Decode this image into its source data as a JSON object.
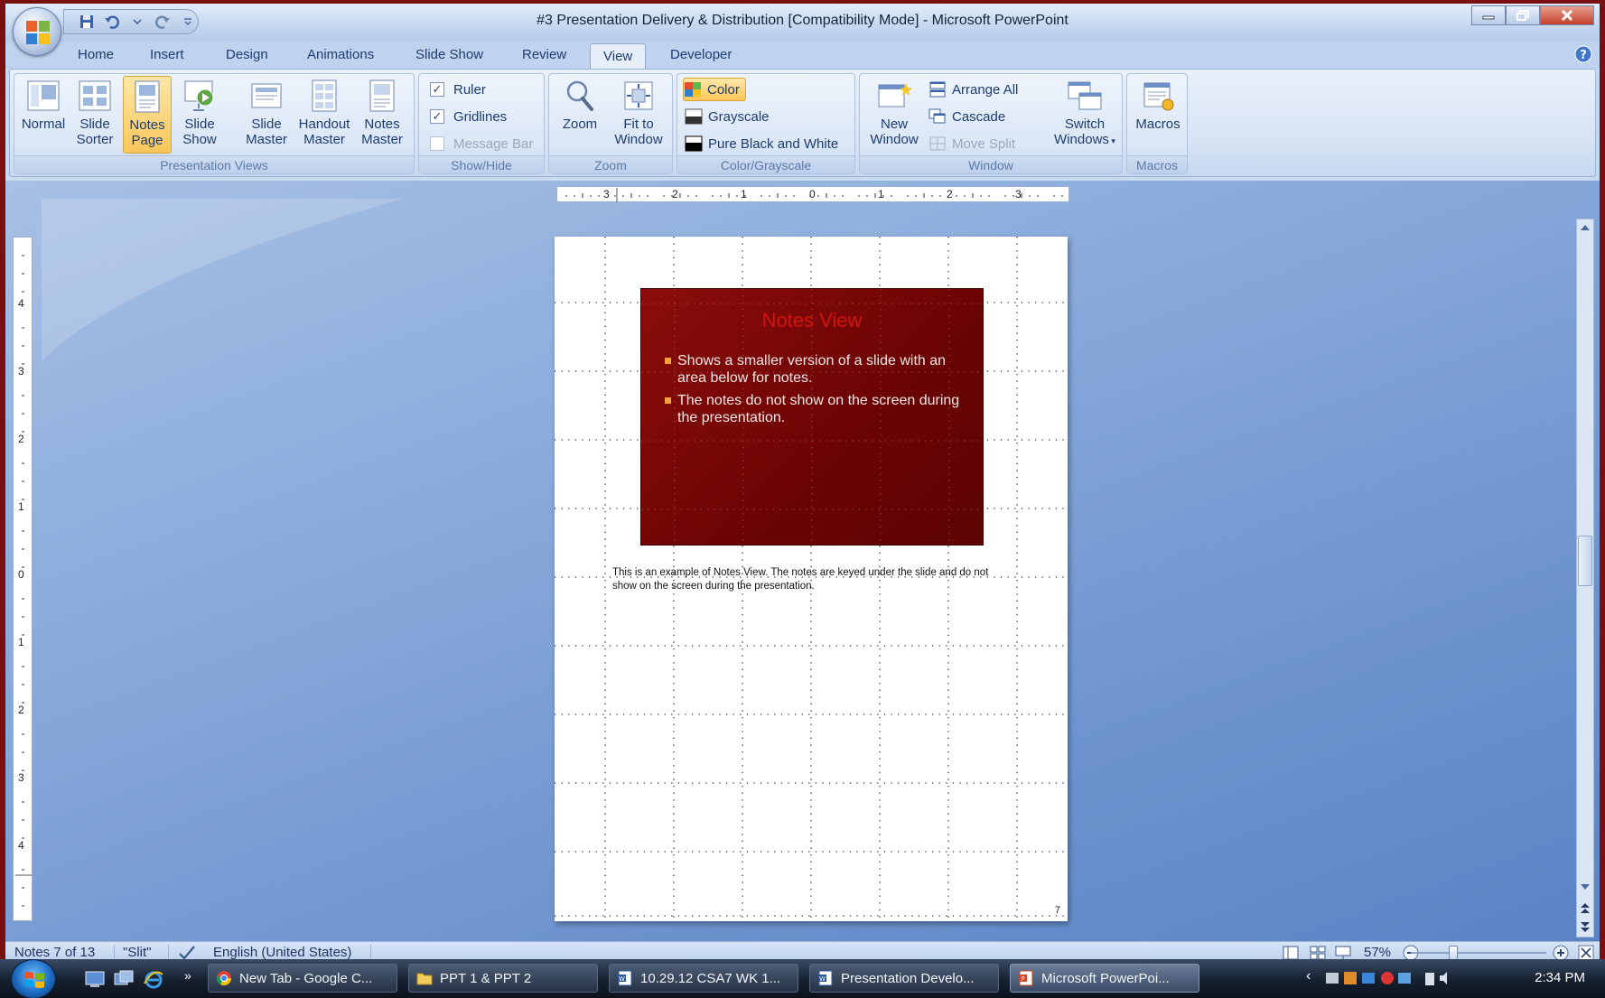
{
  "window": {
    "title": "#3 Presentation Delivery & Distribution [Compatibility Mode] - Microsoft PowerPoint"
  },
  "tabs": [
    "Home",
    "Insert",
    "Design",
    "Animations",
    "Slide Show",
    "Review",
    "View",
    "Developer"
  ],
  "active_tab": "View",
  "ribbon": {
    "presentation_views": {
      "label": "Presentation Views",
      "buttons": [
        {
          "line1": "Normal",
          "line2": ""
        },
        {
          "line1": "Slide",
          "line2": "Sorter"
        },
        {
          "line1": "Notes",
          "line2": "Page"
        },
        {
          "line1": "Slide",
          "line2": "Show"
        },
        {
          "line1": "Slide",
          "line2": "Master"
        },
        {
          "line1": "Handout",
          "line2": "Master"
        },
        {
          "line1": "Notes",
          "line2": "Master"
        }
      ]
    },
    "show_hide": {
      "label": "Show/Hide",
      "ruler": "Ruler",
      "gridlines": "Gridlines",
      "message_bar": "Message Bar"
    },
    "zoom": {
      "label": "Zoom",
      "zoom_line1": "Zoom",
      "fit_line1": "Fit to",
      "fit_line2": "Window"
    },
    "color_grayscale": {
      "label": "Color/Grayscale",
      "color": "Color",
      "grayscale": "Grayscale",
      "pure_bw": "Pure Black and White"
    },
    "window": {
      "label": "Window",
      "new_line1": "New",
      "new_line2": "Window",
      "arrange_all": "Arrange All",
      "cascade": "Cascade",
      "move_split": "Move Split",
      "switch_line1": "Switch",
      "switch_line2": "Windows"
    },
    "macros": {
      "label": "Macros",
      "button": "Macros"
    }
  },
  "rulers": {
    "horizontal_labels": [
      "3",
      "2",
      "1",
      "0",
      "1",
      "2",
      "3"
    ],
    "vertical_labels": [
      "4",
      "3",
      "2",
      "1",
      "0",
      "1",
      "2",
      "3",
      "4"
    ]
  },
  "slide": {
    "title": "Notes View",
    "bullets": [
      "Shows a smaller version of a slide with an area below for notes.",
      "The notes do not show on the screen during the presentation."
    ]
  },
  "notes": {
    "text": "This is an example of Notes View.  The notes are keyed under the slide and do not show on the screen during the presentation.",
    "page_number": "7"
  },
  "statusbar": {
    "position": "Notes 7 of 13",
    "theme": "\"Slit\"",
    "language": "English (United States)",
    "zoom": "57%"
  },
  "taskbar": {
    "items": [
      "New Tab - Google C...",
      "PPT 1 & PPT 2",
      "10.29.12 CSA7 WK 1...",
      "Presentation Develo...",
      "Microsoft PowerPoi..."
    ],
    "clock": "2:34 PM"
  },
  "colors": {
    "slide_background": "#6b0404",
    "slide_title": "#d21410",
    "bullet_marker": "#f2a23c",
    "active_button": "#f9c65a"
  }
}
